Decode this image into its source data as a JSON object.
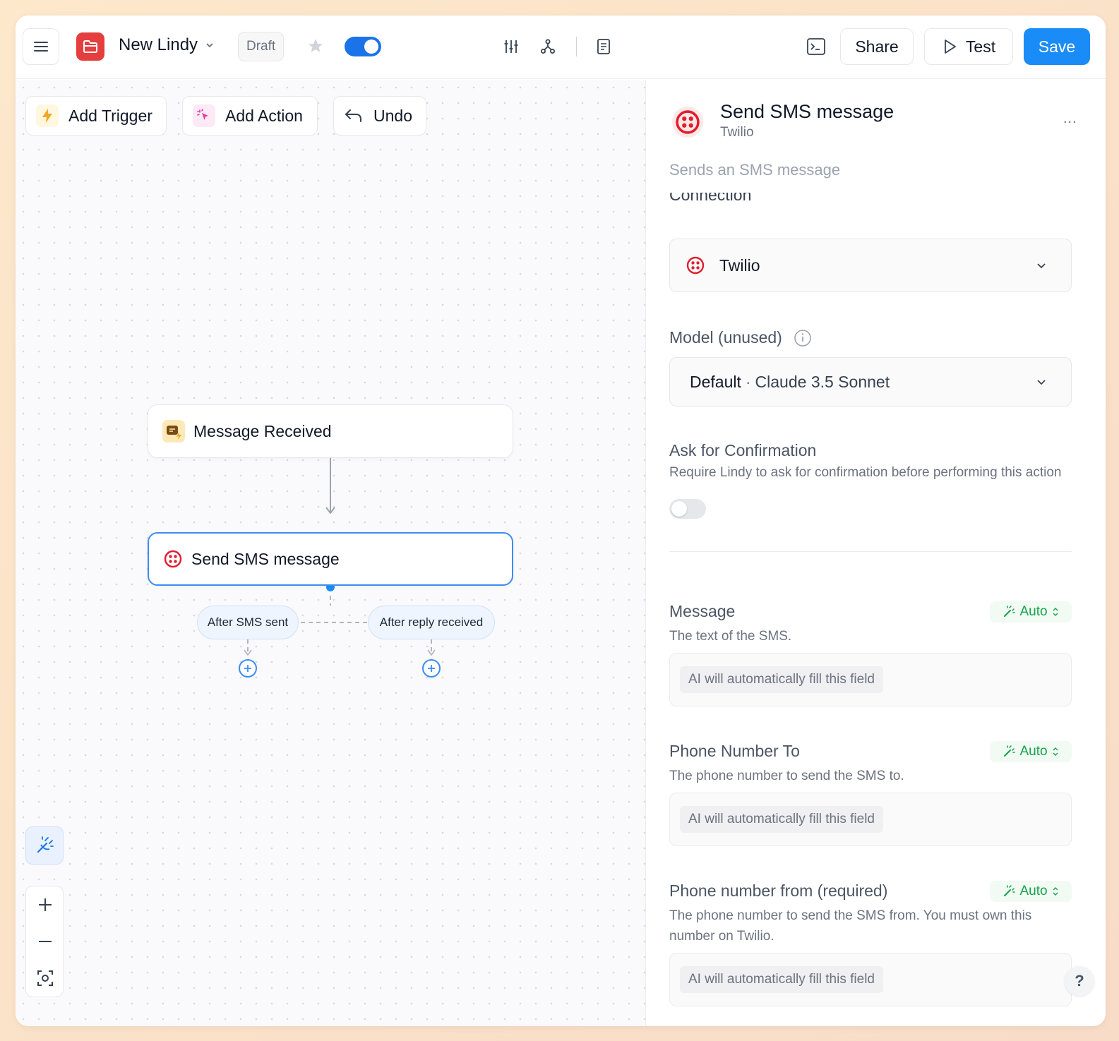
{
  "header": {
    "title": "New Lindy",
    "status": "Draft",
    "share_label": "Share",
    "test_label": "Test",
    "save_label": "Save"
  },
  "toolbar": {
    "add_trigger": "Add Trigger",
    "add_action": "Add Action",
    "undo": "Undo"
  },
  "flow": {
    "trigger_node": "Message Received",
    "action_node": "Send SMS message",
    "branches": [
      "After SMS sent",
      "After reply received"
    ]
  },
  "panel": {
    "title": "Send SMS message",
    "provider": "Twilio",
    "description": "Sends an SMS message",
    "connection_label": "Connection",
    "connection_value": "Twilio",
    "model_label": "Model (unused)",
    "model_default": "Default",
    "model_value": "Claude 3.5 Sonnet",
    "confirm_label": "Ask for Confirmation",
    "confirm_hint": "Require Lindy to ask for confirmation before performing this action",
    "auto_label": "Auto",
    "ai_placeholder": "AI will automatically fill this field",
    "fields": [
      {
        "label": "Message",
        "hint": "The text of the SMS."
      },
      {
        "label": "Phone Number To",
        "hint": "The phone number to send the SMS to."
      },
      {
        "label": "Phone number from (required)",
        "hint": "The phone number to send the SMS from. You must own this number on Twilio."
      }
    ],
    "more": "...",
    "help": "?"
  },
  "colors": {
    "accent": "#1a8cf7",
    "twilio": "#e11d2e",
    "auto_green": "#16a34a"
  }
}
